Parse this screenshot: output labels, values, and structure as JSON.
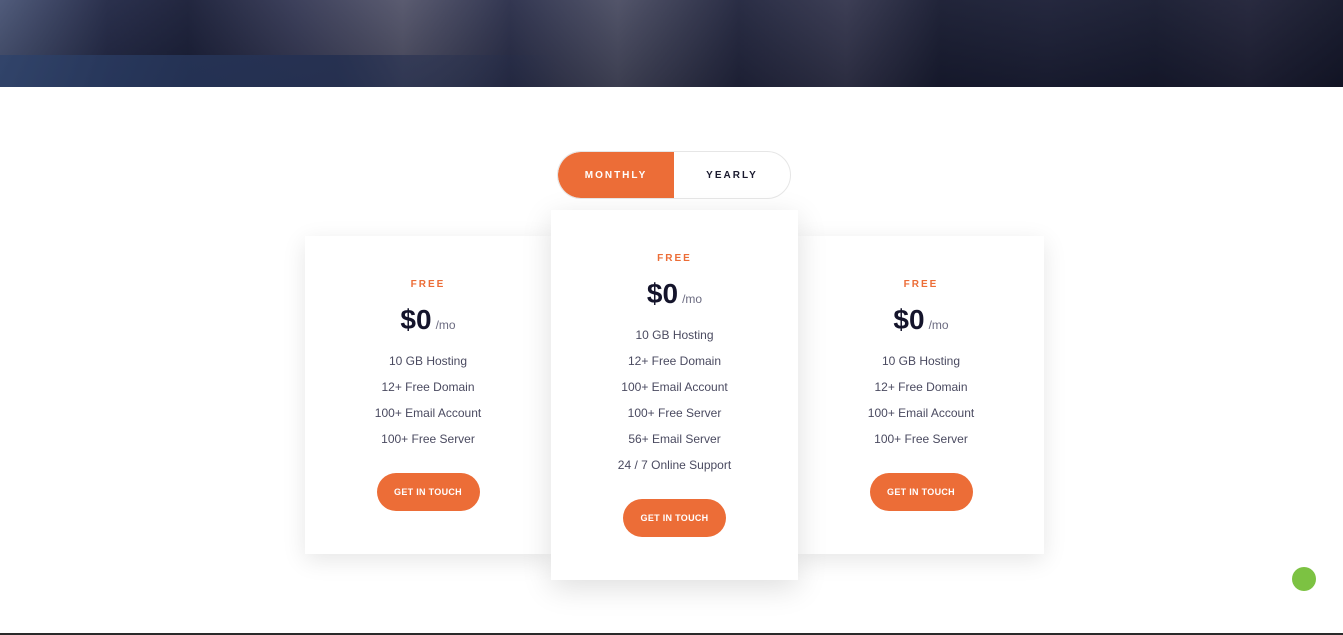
{
  "toggle": {
    "monthly_label": "MONTHLY",
    "yearly_label": "YEARLY",
    "active": "monthly"
  },
  "plans": [
    {
      "name": "FREE",
      "price": "$0",
      "period": "/mo",
      "features": [
        "10 GB Hosting",
        "12+ Free Domain",
        "100+ Email Account",
        "100+ Free Server"
      ],
      "button_label": "GET IN TOUCH"
    },
    {
      "name": "FREE",
      "price": "$0",
      "period": "/mo",
      "features": [
        "10 GB Hosting",
        "12+ Free Domain",
        "100+ Email Account",
        "100+ Free Server",
        "56+ Email Server",
        "24 / 7 Online Support"
      ],
      "button_label": "GET IN TOUCH"
    },
    {
      "name": "FREE",
      "price": "$0",
      "period": "/mo",
      "features": [
        "10 GB Hosting",
        "12+ Free Domain",
        "100+ Email Account",
        "100+ Free Server"
      ],
      "button_label": "GET IN TOUCH"
    }
  ],
  "colors": {
    "accent": "#ec6d37",
    "chat": "#7cc242",
    "text_dark": "#14142b"
  },
  "icons": {
    "chat_widget": "chat-bubble-icon"
  }
}
